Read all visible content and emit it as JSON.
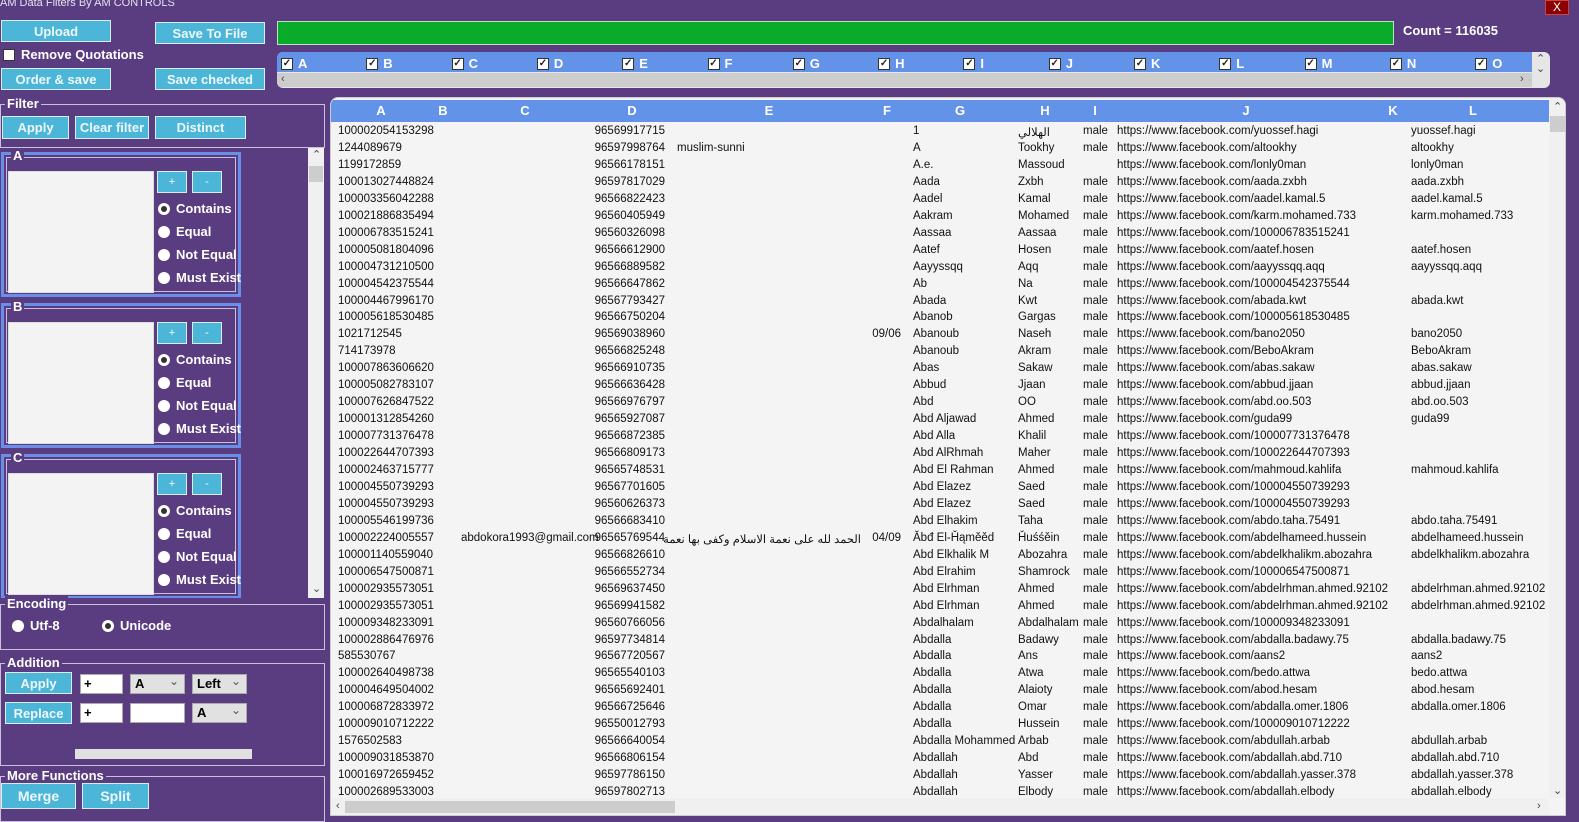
{
  "window": {
    "title": "AM Data Filters By AM CONTROLS",
    "close_label": "X"
  },
  "toolbar": {
    "upload": "Upload",
    "save_to_file": "Save To File",
    "remove_quotations": "Remove Quotations",
    "order_save": "Order & save",
    "save_checked": "Save checked"
  },
  "progress": {
    "percent": 100,
    "count_label": "Count = 116035"
  },
  "column_checks": [
    "A",
    "B",
    "C",
    "D",
    "E",
    "F",
    "G",
    "H",
    "I",
    "J",
    "K",
    "L",
    "M",
    "N",
    "O"
  ],
  "filter": {
    "title": "Filter",
    "apply": "Apply",
    "clear": "Clear filter",
    "distinct": "Distinct",
    "groups": [
      {
        "name": "A"
      },
      {
        "name": "B"
      },
      {
        "name": "C"
      }
    ],
    "plus": "+",
    "minus": "-",
    "modes": [
      "Contains",
      "Equal",
      "Not Equal",
      "Must Exist"
    ],
    "selected_mode": "Contains"
  },
  "encoding": {
    "title": "Encoding",
    "options": [
      "Utf-8",
      "Unicode"
    ],
    "selected": "Unicode"
  },
  "addition": {
    "title": "Addition",
    "apply": "Apply",
    "replace": "Replace",
    "apply_text": "+",
    "apply_column": "A",
    "apply_side": "Left",
    "replace_text": "+",
    "replace_with": "",
    "replace_column": "A"
  },
  "more": {
    "title": "More Functions",
    "merge": "Merge",
    "split": "Split"
  },
  "grid": {
    "headers": [
      "A",
      "B",
      "C",
      "D",
      "E",
      "F",
      "G",
      "H",
      "I",
      "J",
      "K",
      "L"
    ],
    "rows": [
      [
        "100002054153298",
        "",
        "",
        "96569917715",
        "",
        "",
        "1",
        "الهلالي",
        "male",
        "https://www.facebook.com/yuossef.hagi",
        "",
        "yuossef.hagi"
      ],
      [
        "1244089679",
        "",
        "",
        "96597998764",
        "muslim-sunni",
        "",
        "A",
        "Tookhy",
        "male",
        "https://www.facebook.com/altookhy",
        "",
        "altookhy"
      ],
      [
        "1199172859",
        "",
        "",
        "96566178151",
        "",
        "",
        "A.e.",
        "Massoud",
        "",
        "https://www.facebook.com/lonly0man",
        "",
        "lonly0man"
      ],
      [
        "100013027448824",
        "",
        "",
        "96597817029",
        "",
        "",
        "Aada",
        "Zxbh",
        "male",
        "https://www.facebook.com/aada.zxbh",
        "",
        "aada.zxbh"
      ],
      [
        "100003356042288",
        "",
        "",
        "96566822423",
        "",
        "",
        "Aadel",
        "Kamal",
        "male",
        "https://www.facebook.com/aadel.kamal.5",
        "",
        "aadel.kamal.5"
      ],
      [
        "100021886835494",
        "",
        "",
        "96560405949",
        "",
        "",
        "Aakram",
        "Mohamed",
        "male",
        "https://www.facebook.com/karm.mohamed.733",
        "",
        "karm.mohamed.733"
      ],
      [
        "100006783515241",
        "",
        "",
        "96560326098",
        "",
        "",
        "Aassaa",
        "Aassaa",
        "male",
        "https://www.facebook.com/100006783515241",
        "",
        ""
      ],
      [
        "100005081804096",
        "",
        "",
        "96566612900",
        "",
        "",
        "Aatef",
        "Hosen",
        "male",
        "https://www.facebook.com/aatef.hosen",
        "",
        "aatef.hosen"
      ],
      [
        "100004731210500",
        "",
        "",
        "96566889582",
        "",
        "",
        "Aayyssqq",
        "Aqq",
        "male",
        "https://www.facebook.com/aayyssqq.aqq",
        "",
        "aayyssqq.aqq"
      ],
      [
        "100004542375544",
        "",
        "",
        "96566647862",
        "",
        "",
        "Ab",
        "Na",
        "male",
        "https://www.facebook.com/100004542375544",
        "",
        ""
      ],
      [
        "100004467996170",
        "",
        "",
        "96567793427",
        "",
        "",
        "Abada",
        "Kwt",
        "male",
        "https://www.facebook.com/abada.kwt",
        "",
        "abada.kwt"
      ],
      [
        "100005618530485",
        "",
        "",
        "96566750204",
        "",
        "",
        "Abanob",
        "Gargas",
        "male",
        "https://www.facebook.com/100005618530485",
        "",
        ""
      ],
      [
        "1021712545",
        "",
        "",
        "96569038960",
        "",
        "09/06",
        "Abanoub",
        "Naseh",
        "male",
        "https://www.facebook.com/bano2050",
        "",
        "bano2050"
      ],
      [
        "714173978",
        "",
        "",
        "96566825248",
        "",
        "",
        "Abanoub",
        "Akram",
        "male",
        "https://www.facebook.com/BeboAkram",
        "",
        "BeboAkram"
      ],
      [
        "100007863606620",
        "",
        "",
        "96566910735",
        "",
        "",
        "Abas",
        "Sakaw",
        "male",
        "https://www.facebook.com/abas.sakaw",
        "",
        "abas.sakaw"
      ],
      [
        "100005082783107",
        "",
        "",
        "96566636428",
        "",
        "",
        "Abbud",
        "Jjaan",
        "male",
        "https://www.facebook.com/abbud.jjaan",
        "",
        "abbud.jjaan"
      ],
      [
        "100007626847522",
        "",
        "",
        "96566976797",
        "",
        "",
        "Abd",
        "OO",
        "male",
        "https://www.facebook.com/abd.oo.503",
        "",
        "abd.oo.503"
      ],
      [
        "100001312854260",
        "",
        "",
        "96565927087",
        "",
        "",
        "Abd Aljawad",
        "Ahmed",
        "male",
        "https://www.facebook.com/guda99",
        "",
        "guda99"
      ],
      [
        "100007731376478",
        "",
        "",
        "96566872385",
        "",
        "",
        "Abd Alla",
        "Khalil",
        "male",
        "https://www.facebook.com/100007731376478",
        "",
        ""
      ],
      [
        "100022644707393",
        "",
        "",
        "96566809173",
        "",
        "",
        "Abd AlRhmah",
        "Maher",
        "male",
        "https://www.facebook.com/100022644707393",
        "",
        ""
      ],
      [
        "100002463715777",
        "",
        "",
        "96565748531",
        "",
        "",
        "Abd El Rahman",
        "Ahmed",
        "male",
        "https://www.facebook.com/mahmoud.kahlifa",
        "",
        "mahmoud.kahlifa"
      ],
      [
        "100004550739293",
        "",
        "",
        "96567701605",
        "",
        "",
        "Abd Elazez",
        "Saed",
        "male",
        "https://www.facebook.com/100004550739293",
        "",
        ""
      ],
      [
        "100004550739293",
        "",
        "",
        "96560626373",
        "",
        "",
        "Abd Elazez",
        "Saed",
        "male",
        "https://www.facebook.com/100004550739293",
        "",
        ""
      ],
      [
        "100005546199736",
        "",
        "",
        "96566683410",
        "",
        "",
        "Abd Elhakim",
        "Taha",
        "male",
        "https://www.facebook.com/abdo.taha.75491",
        "",
        "abdo.taha.75491"
      ],
      [
        "100002224005557",
        "",
        "abdokora1993@gmail.com",
        "96565769544",
        "الحمد لله على نعمة الاسلام وكفى بها نعمة",
        "04/09",
        "Ăbđ El-Ȟąměěd",
        "Ȟuśśěin",
        "male",
        "https://www.facebook.com/abdelhameed.hussein",
        "",
        "abdelhameed.hussein"
      ],
      [
        "100001140559040",
        "",
        "",
        "96566826610",
        "",
        "",
        "Abd Elkhalik M",
        "Abozahra",
        "male",
        "https://www.facebook.com/abdelkhalikm.abozahra",
        "",
        "abdelkhalikm.abozahra"
      ],
      [
        "100006547500871",
        "",
        "",
        "96566552734",
        "",
        "",
        "Abd Elrahim",
        "Shamrock",
        "male",
        "https://www.facebook.com/100006547500871",
        "",
        ""
      ],
      [
        "100002935573051",
        "",
        "",
        "96569637450",
        "",
        "",
        "Abd Elrhman",
        "Ahmed",
        "male",
        "https://www.facebook.com/abdelrhman.ahmed.92102",
        "",
        "abdelrhman.ahmed.92102"
      ],
      [
        "100002935573051",
        "",
        "",
        "96569941582",
        "",
        "",
        "Abd Elrhman",
        "Ahmed",
        "male",
        "https://www.facebook.com/abdelrhman.ahmed.92102",
        "",
        "abdelrhman.ahmed.92102"
      ],
      [
        "100009348233091",
        "",
        "",
        "96560766056",
        "",
        "",
        "Abdalhalam",
        "Abdalhalam",
        "male",
        "https://www.facebook.com/100009348233091",
        "",
        ""
      ],
      [
        "100002886476976",
        "",
        "",
        "96597734814",
        "",
        "",
        "Abdalla",
        "Badawy",
        "male",
        "https://www.facebook.com/abdalla.badawy.75",
        "",
        "abdalla.badawy.75"
      ],
      [
        "585530767",
        "",
        "",
        "96567720567",
        "",
        "",
        "Abdalla",
        "Ans",
        "male",
        "https://www.facebook.com/aans2",
        "",
        "aans2"
      ],
      [
        "100002640498738",
        "",
        "",
        "96565540103",
        "",
        "",
        "Abdalla",
        "Atwa",
        "male",
        "https://www.facebook.com/bedo.attwa",
        "",
        "bedo.attwa"
      ],
      [
        "100004649504002",
        "",
        "",
        "96565692401",
        "",
        "",
        "Abdalla",
        "Alaioty",
        "male",
        "https://www.facebook.com/abod.hesam",
        "",
        "abod.hesam"
      ],
      [
        "100006872833972",
        "",
        "",
        "96566725646",
        "",
        "",
        "Abdalla",
        "Omar",
        "male",
        "https://www.facebook.com/abdalla.omer.1806",
        "",
        "abdalla.omer.1806"
      ],
      [
        "100009010712222",
        "",
        "",
        "96550012793",
        "",
        "",
        "Abdalla",
        "Hussein",
        "male",
        "https://www.facebook.com/100009010712222",
        "",
        ""
      ],
      [
        "1576502583",
        "",
        "",
        "96566640054",
        "",
        "",
        "Abdalla Mohammed",
        "Arbab",
        "male",
        "https://www.facebook.com/abdullah.arbab",
        "",
        "abdullah.arbab"
      ],
      [
        "100009031853870",
        "",
        "",
        "96566806154",
        "",
        "",
        "Abdallah",
        "Abd",
        "male",
        "https://www.facebook.com/abdallah.abd.710",
        "",
        "abdallah.abd.710"
      ],
      [
        "100016972659452",
        "",
        "",
        "96597786150",
        "",
        "",
        "Abdallah",
        "Yasser",
        "male",
        "https://www.facebook.com/abdallah.yasser.378",
        "",
        "abdallah.yasser.378"
      ],
      [
        "100002689533003",
        "",
        "",
        "96597802713",
        "",
        "",
        "Abdallah",
        "Elbody",
        "male",
        "https://www.facebook.com/abdallah.elbody",
        "",
        "abdallah.elbody"
      ]
    ]
  },
  "colors": {
    "background": "#5a3d80",
    "button": "#4cb6d9",
    "header": "#6393e8",
    "progress": "#08ac2a",
    "close": "#8b0000"
  }
}
